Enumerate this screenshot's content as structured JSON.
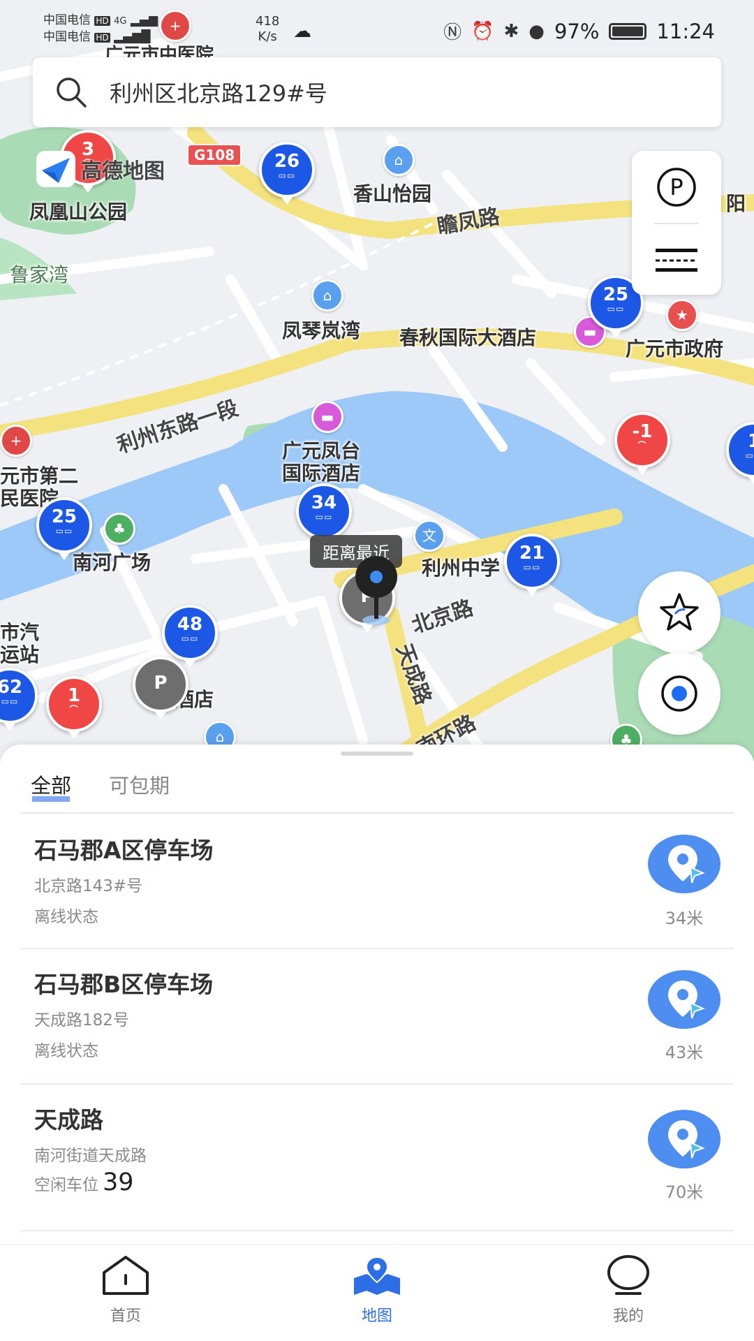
{
  "status_bar": {
    "carrier_1": "中国电信",
    "carrier_2": "中国电信",
    "hd_badge": "HD",
    "network_1": "4G",
    "speed_value": "418",
    "speed_unit": "K/s",
    "battery": "97%",
    "time": "11:24"
  },
  "search": {
    "value": "利州区北京路129#号"
  },
  "map": {
    "logo_text": "高德地图",
    "road_badge": "G108",
    "labels": {
      "hospital_top": "广元市中医院",
      "fenghuang_park": "凤凰山公园",
      "lujiawan": "鲁家湾",
      "xiangshan": "香山怡园",
      "zhanfeng_road": "瞻凤路",
      "yang_partial": "阳",
      "fengqin": "凤琴岚湾",
      "chunqiu_hotel": "春秋国际大酒店",
      "gov": "广元市政府",
      "lizhou_east": "利州东路一段",
      "fengtai_hotel_1": "广元凤台",
      "fengtai_hotel_2": "国际酒店",
      "hospital2_1": "元市第二",
      "hospital2_2": "民医院",
      "nanhe_square": "南河广场",
      "bus_station_1": "市汽",
      "bus_station_2": "运站",
      "lizhou_school": "利州中学",
      "beijing_road": "北京路",
      "tiancheng_road": "天成路",
      "nanhuan_road": "南环路",
      "hotel_bottom": "城酒店"
    },
    "pins": {
      "p26": "26",
      "p25a": "25",
      "p25b": "25",
      "p34": "34",
      "p21": "21",
      "p48": "48",
      "p62": "62",
      "p3": "3",
      "p_minus1": "-1",
      "p1": "1",
      "p1b": "1",
      "parking_letter": "P"
    },
    "tooltip": "距离最近"
  },
  "sheet": {
    "tabs": [
      "全部",
      "可包期"
    ],
    "items": [
      {
        "name": "石马郡A区停车场",
        "address": "北京路143#号",
        "status": "离线状态",
        "spots": "",
        "distance": "34米"
      },
      {
        "name": "石马郡B区停车场",
        "address": "天成路182号",
        "status": "离线状态",
        "spots": "",
        "distance": "43米"
      },
      {
        "name": "天成路",
        "address": "南河街道天成路",
        "status": "空闲车位",
        "spots": "39",
        "distance": "70米"
      }
    ]
  },
  "navbar": {
    "items": [
      {
        "label": "首页",
        "icon": "home-icon"
      },
      {
        "label": "地图",
        "icon": "map-icon"
      },
      {
        "label": "我的",
        "icon": "profile-icon"
      }
    ],
    "active": "地图"
  },
  "colors": {
    "accent": "#2c6ee6",
    "pin_blue": "#1d57e5",
    "pin_red": "#f04646",
    "river": "#9cc9f7",
    "road_yellow": "#f6e27a",
    "park_green": "#a5dbb0"
  }
}
